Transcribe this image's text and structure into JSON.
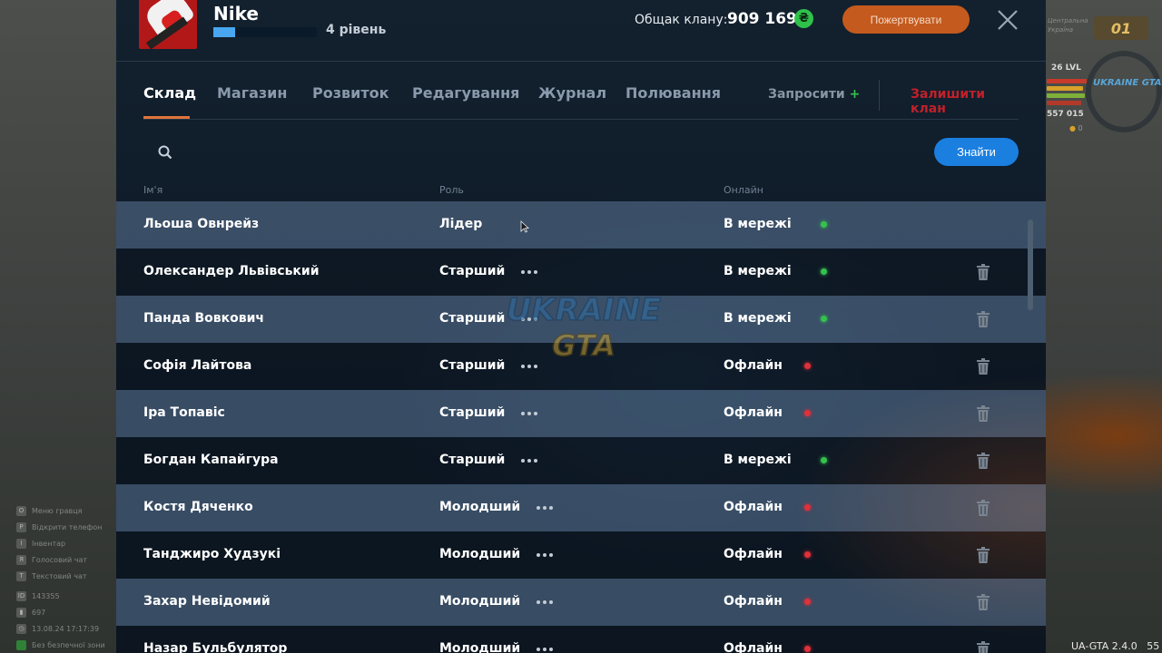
{
  "header": {
    "clan_name": "Nike",
    "level_label": "4 рівень",
    "xp_progress": 0.21,
    "total_label": "Общак клану:",
    "total_value": "909 169",
    "currency_symbol": "₴",
    "donate_label": "Пожертвувати"
  },
  "tabs": [
    {
      "label": "Склад",
      "active": true
    },
    {
      "label": "Магазин",
      "active": false
    },
    {
      "label": "Розвиток",
      "active": false
    },
    {
      "label": "Редагування",
      "active": false
    },
    {
      "label": "Журнал",
      "active": false
    },
    {
      "label": "Полювання",
      "active": false
    }
  ],
  "actions": {
    "invite_label": "Запросити",
    "invite_plus": "+",
    "leave_label": "Залишити клан"
  },
  "search": {
    "placeholder": "",
    "find_label": "Знайти"
  },
  "table": {
    "headers": {
      "name": "Ім'я",
      "role": "Роль",
      "online": "Онлайн"
    },
    "rows": [
      {
        "name": "Льоша Овнрейз",
        "role": "Лідер",
        "status": "В мережі",
        "online": true
      },
      {
        "name": "Олександер Львівський",
        "role": "Старший",
        "status": "В мережі",
        "online": true
      },
      {
        "name": "Панда Вовкович",
        "role": "Старший",
        "status": "В мережі",
        "online": true
      },
      {
        "name": "Софія Лайтова",
        "role": "Старший",
        "status": "Офлайн",
        "online": false
      },
      {
        "name": "Іра Топавіс",
        "role": "Старший",
        "status": "Офлайн",
        "online": false
      },
      {
        "name": "Богдан Капайгура",
        "role": "Старший",
        "status": "В мережі",
        "online": true
      },
      {
        "name": "Костя Дяченко",
        "role": "Молодший",
        "status": "Офлайн",
        "online": false
      },
      {
        "name": "Танджиро Худзукі",
        "role": "Молодший",
        "status": "Офлайн",
        "online": false
      },
      {
        "name": "Захар Невідомий",
        "role": "Молодший",
        "status": "Офлайн",
        "online": false
      },
      {
        "name": "Назар Бульбулятор",
        "role": "Молодший",
        "status": "Офлайн",
        "online": false
      }
    ]
  },
  "watermark": {
    "line1": "UKRAINE",
    "line2": "GTA"
  },
  "hud": {
    "region": "Центральна Україна",
    "zone_number": "01",
    "level": "26 LVL",
    "money": "557 015",
    "zero": "0",
    "logo": "UKRAINE GTA",
    "version": "UA-GTA 2.4.0",
    "version_suffix": "55",
    "hints": [
      {
        "key": "O",
        "text": "Меню гравця"
      },
      {
        "key": "P",
        "text": "Відкрити телефон"
      },
      {
        "key": "I",
        "text": "Інвентар"
      },
      {
        "key": "Я",
        "text": "Голосовий чат"
      },
      {
        "key": "T",
        "text": "Текстовий чат"
      }
    ],
    "id_label": "ID",
    "id_value": "143355",
    "ping_value": "697",
    "datetime": "13.08.24 17:17:39",
    "status_line": "Без безпечної зони"
  },
  "colors": {
    "accent_orange": "#e0743a",
    "donate_bg": "#c45a1d",
    "find_bg": "#1b7fe0",
    "online_green": "#35c24c",
    "offline_red": "#e0303a",
    "leave_red": "#c0202a"
  },
  "icons": {
    "search": "magnifier",
    "close": "x",
    "coin": "hryvnia-coin",
    "delete": "trash-can",
    "more": "three-dots"
  }
}
